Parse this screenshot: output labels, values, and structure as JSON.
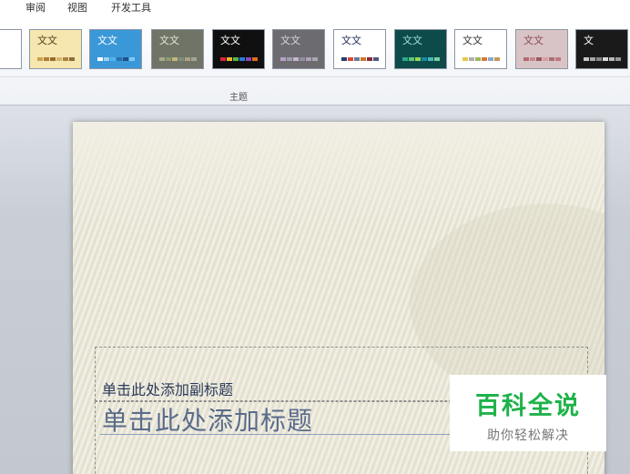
{
  "tabs": [
    {
      "label": "审阅"
    },
    {
      "label": "视图"
    },
    {
      "label": "开发工具"
    }
  ],
  "themes": {
    "group_label": "主题",
    "items": [
      {
        "text": "",
        "bg": "#ffffff",
        "fg": "#333333",
        "swatches": [
          "#8cc63e",
          "#8cc63e",
          "#8cc63e"
        ]
      },
      {
        "text": "文文",
        "bg": "#f6e6b0",
        "fg": "#5a3b1b",
        "swatches": [
          "#c9a24a",
          "#b07c3a",
          "#9a6a2e",
          "#d2b86b",
          "#a9823f",
          "#8c6b3b"
        ]
      },
      {
        "text": "文文",
        "bg": "#3b98d8",
        "fg": "#ffffff",
        "swatches": [
          "#ffffff",
          "#9bd0f2",
          "#4cb6ec",
          "#2a6fb0",
          "#1f4f8a",
          "#7ec8f0"
        ]
      },
      {
        "text": "文文",
        "bg": "#6f7466",
        "fg": "#e6e6d6",
        "swatches": [
          "#a9a98a",
          "#8b9a6a",
          "#c4b47c",
          "#7c8f7a",
          "#b0a08a",
          "#9fa890"
        ]
      },
      {
        "text": "文文",
        "bg": "#0f0f10",
        "fg": "#ffffff",
        "swatches": [
          "#d9243c",
          "#f0b428",
          "#52b848",
          "#2c7bd6",
          "#8a48b8",
          "#e06c1a"
        ]
      },
      {
        "text": "文文",
        "bg": "#6b6b70",
        "fg": "#d9d9dc",
        "swatches": [
          "#b6a0c8",
          "#a0a0a8",
          "#c8b4d0",
          "#9090a0",
          "#b0a0b8",
          "#a8a8b0"
        ]
      },
      {
        "text": "文文",
        "bg": "#ffffff",
        "fg": "#1d2a5a",
        "swatches": [
          "#2a3a6a",
          "#d44a3a",
          "#6a7a9a",
          "#c8782a",
          "#8a2a3a",
          "#4a5a7a"
        ]
      },
      {
        "text": "文文",
        "bg": "#0d4a4a",
        "fg": "#9ee0d8",
        "swatches": [
          "#2aa88a",
          "#5ac878",
          "#9ad858",
          "#1a8aa8",
          "#4ab8b8",
          "#7ad0a0"
        ]
      },
      {
        "text": "文文",
        "bg": "#ffffff",
        "fg": "#333333",
        "swatches": [
          "#e8ca48",
          "#b0b0b0",
          "#9ab85a",
          "#d87838",
          "#8aa8c8",
          "#c89858"
        ]
      },
      {
        "text": "文文",
        "bg": "#d8c4c6",
        "fg": "#8a4a52",
        "swatches": [
          "#b46a72",
          "#c88a8a",
          "#9a5a62",
          "#d4a0a0",
          "#a87078",
          "#c07880"
        ]
      },
      {
        "text": "文",
        "bg": "#1a1a1a",
        "fg": "#ffffff",
        "swatches": [
          "#c8c8c8",
          "#a8a8a8",
          "#888888",
          "#d8d8d8",
          "#b8b8b8",
          "#989898"
        ]
      }
    ]
  },
  "slide": {
    "subtitle": "单击此处添加副标题",
    "title": "单击此处添加标题"
  },
  "watermark": {
    "main": "百科全说",
    "sub": "助你轻松解决"
  }
}
